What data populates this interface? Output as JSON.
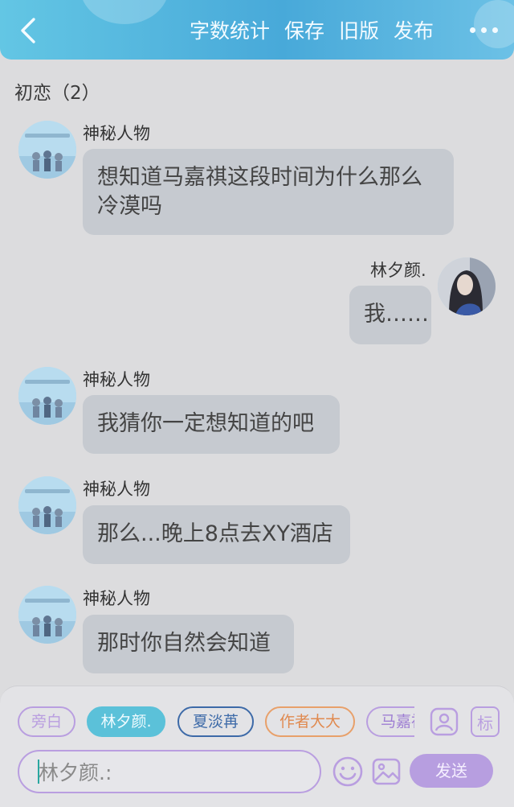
{
  "header": {
    "actions": [
      "字数统计",
      "保存",
      "旧版",
      "发布"
    ]
  },
  "chat": {
    "title": "初恋（2）",
    "messages": [
      {
        "sender": "神秘人物",
        "text_lines": [
          "想知道马嘉祺这段时间为什么那么",
          "冷漠吗"
        ],
        "side": "left"
      },
      {
        "sender": "林夕颜.",
        "text_lines": [
          "我……"
        ],
        "side": "right"
      },
      {
        "sender": "神秘人物",
        "text_lines": [
          "我猜你一定想知道的吧"
        ],
        "side": "left"
      },
      {
        "sender": "神秘人物",
        "text_lines": [
          "那么...晚上8点去XY酒店"
        ],
        "side": "left"
      },
      {
        "sender": "神秘人物",
        "text_lines": [
          "那时你自然会知道"
        ],
        "side": "left"
      }
    ]
  },
  "input_bar": {
    "roles": [
      {
        "label": "旁白",
        "color": "#b99ee0",
        "selected": false
      },
      {
        "label": "林夕颜.",
        "color": "#5bc1d9",
        "selected": true
      },
      {
        "label": "夏淡苒",
        "color": "#3d6aa8",
        "selected": false
      },
      {
        "label": "作者大大",
        "color": "#e8a06a",
        "selected": false
      },
      {
        "label": "马嘉祺",
        "color": "#b99ee0",
        "selected": false
      }
    ],
    "role_settings_icon": "person-card-icon",
    "mark_button": "标",
    "input_value": "林夕颜.:",
    "emoji_icon": "smiley-icon",
    "image_icon": "image-icon",
    "send_label": "发送",
    "accent_color": "#b79ee0"
  }
}
